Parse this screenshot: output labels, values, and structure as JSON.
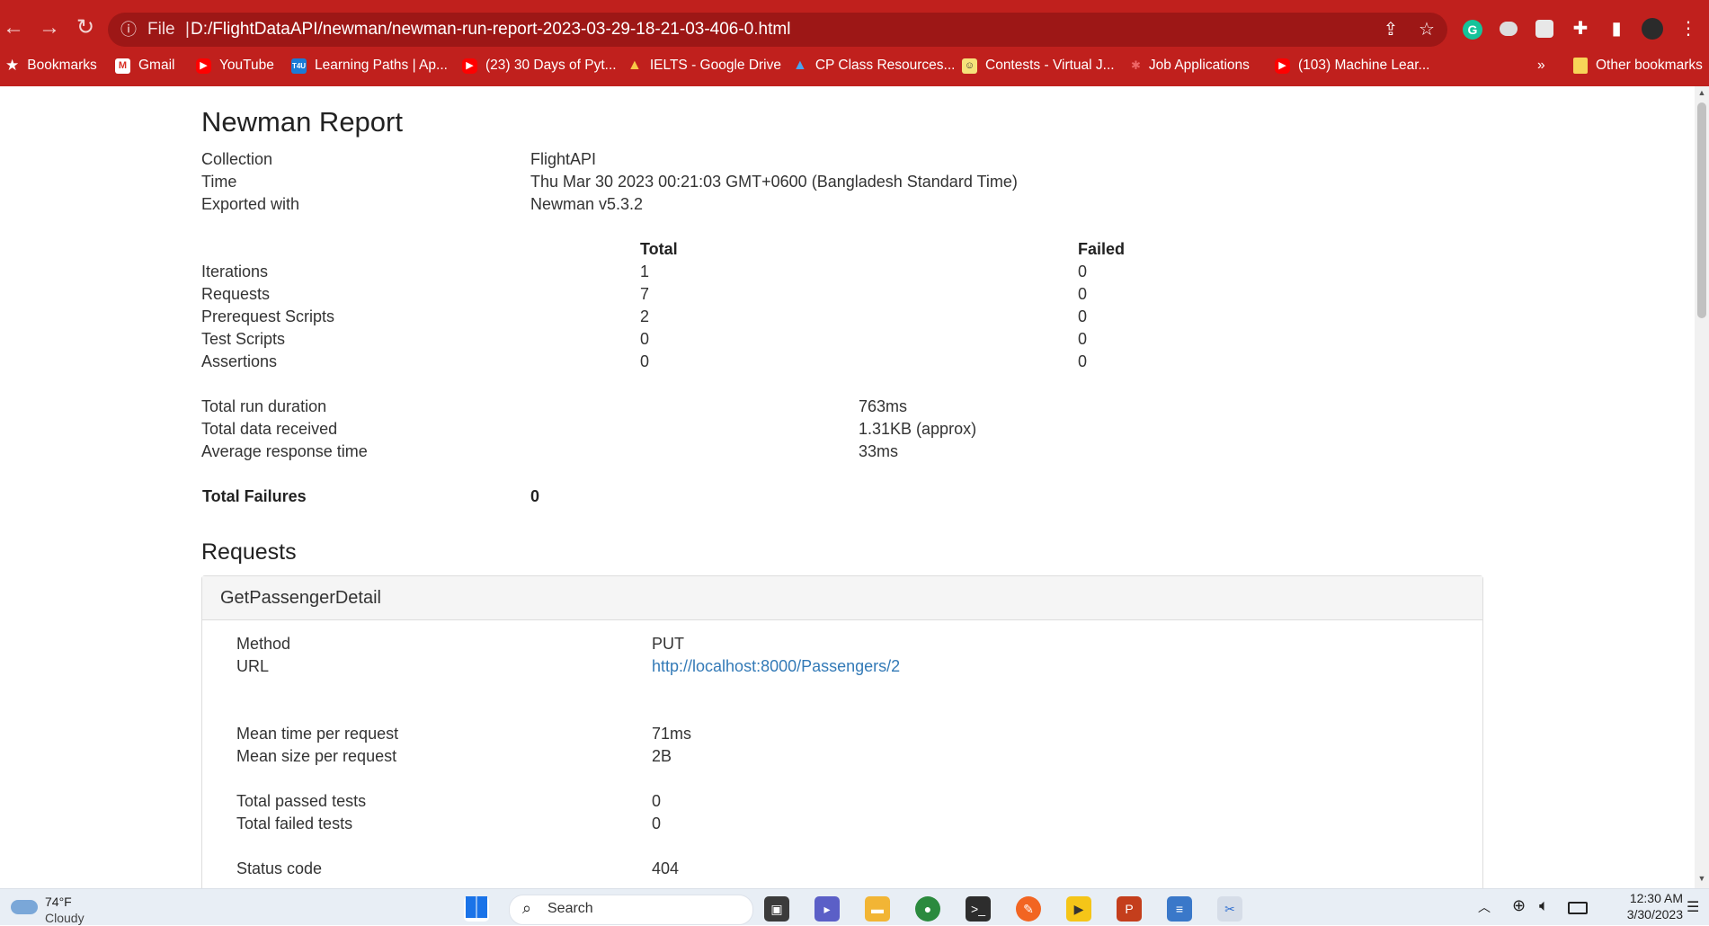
{
  "browser": {
    "file_label": "File",
    "address": "D:/FlightDataAPI/newman/newman-run-report-2023-03-29-18-21-03-406-0.html",
    "bookmarks": [
      {
        "label": "Bookmarks",
        "icon": "star-icon"
      },
      {
        "label": "Gmail",
        "icon": "gmail-icon"
      },
      {
        "label": "YouTube",
        "icon": "youtube-icon"
      },
      {
        "label": "Learning Paths | Ap...",
        "icon": "t4u-icon"
      },
      {
        "label": "(23) 30 Days of Pyt...",
        "icon": "youtube-icon"
      },
      {
        "label": "IELTS - Google Drive",
        "icon": "google-drive-icon"
      },
      {
        "label": "CP Class Resources...",
        "icon": "google-drive-icon"
      },
      {
        "label": "Contests - Virtual J...",
        "icon": "vjudge-icon"
      },
      {
        "label": "Job Applications",
        "icon": "pin-icon"
      },
      {
        "label": "(103) Machine Lear...",
        "icon": "youtube-icon"
      }
    ],
    "overflow_label": "»",
    "other_bookmarks": "Other bookmarks"
  },
  "report": {
    "title": "Newman Report",
    "meta": [
      {
        "label": "Collection",
        "value": "FlightAPI"
      },
      {
        "label": "Time",
        "value": "Thu Mar 30 2023 00:21:03 GMT+0600 (Bangladesh Standard Time)"
      },
      {
        "label": "Exported with",
        "value": "Newman v5.3.2"
      }
    ],
    "summary_headers": {
      "total": "Total",
      "failed": "Failed"
    },
    "summary": [
      {
        "label": "Iterations",
        "total": "1",
        "failed": "0"
      },
      {
        "label": "Requests",
        "total": "7",
        "failed": "0"
      },
      {
        "label": "Prerequest Scripts",
        "total": "2",
        "failed": "0"
      },
      {
        "label": "Test Scripts",
        "total": "0",
        "failed": "0"
      },
      {
        "label": "Assertions",
        "total": "0",
        "failed": "0"
      }
    ],
    "stats": [
      {
        "label": "Total run duration",
        "value": "763ms"
      },
      {
        "label": "Total data received",
        "value": "1.31KB (approx)"
      },
      {
        "label": "Average response time",
        "value": "33ms"
      }
    ],
    "total_failures_label": "Total Failures",
    "total_failures_value": "0",
    "requests_heading": "Requests",
    "request": {
      "name": "GetPassengerDetail",
      "rows": [
        {
          "label": "Method",
          "value": "PUT"
        },
        {
          "label": "URL",
          "value": "http://localhost:8000/Passengers/2"
        },
        {
          "label": "Mean time per request",
          "value": "71ms"
        },
        {
          "label": "Mean size per request",
          "value": "2B"
        },
        {
          "label": "Total passed tests",
          "value": "0"
        },
        {
          "label": "Total failed tests",
          "value": "0"
        },
        {
          "label": "Status code",
          "value": "404"
        }
      ]
    }
  },
  "taskbar": {
    "temperature": "74°F",
    "weather": "Cloudy",
    "search_label": "Search",
    "time": "12:30 AM",
    "date": "3/30/2023"
  },
  "colors": {
    "chrome_red": "#c0201d",
    "omnibox": "#9d1716",
    "link": "#337ab7"
  }
}
